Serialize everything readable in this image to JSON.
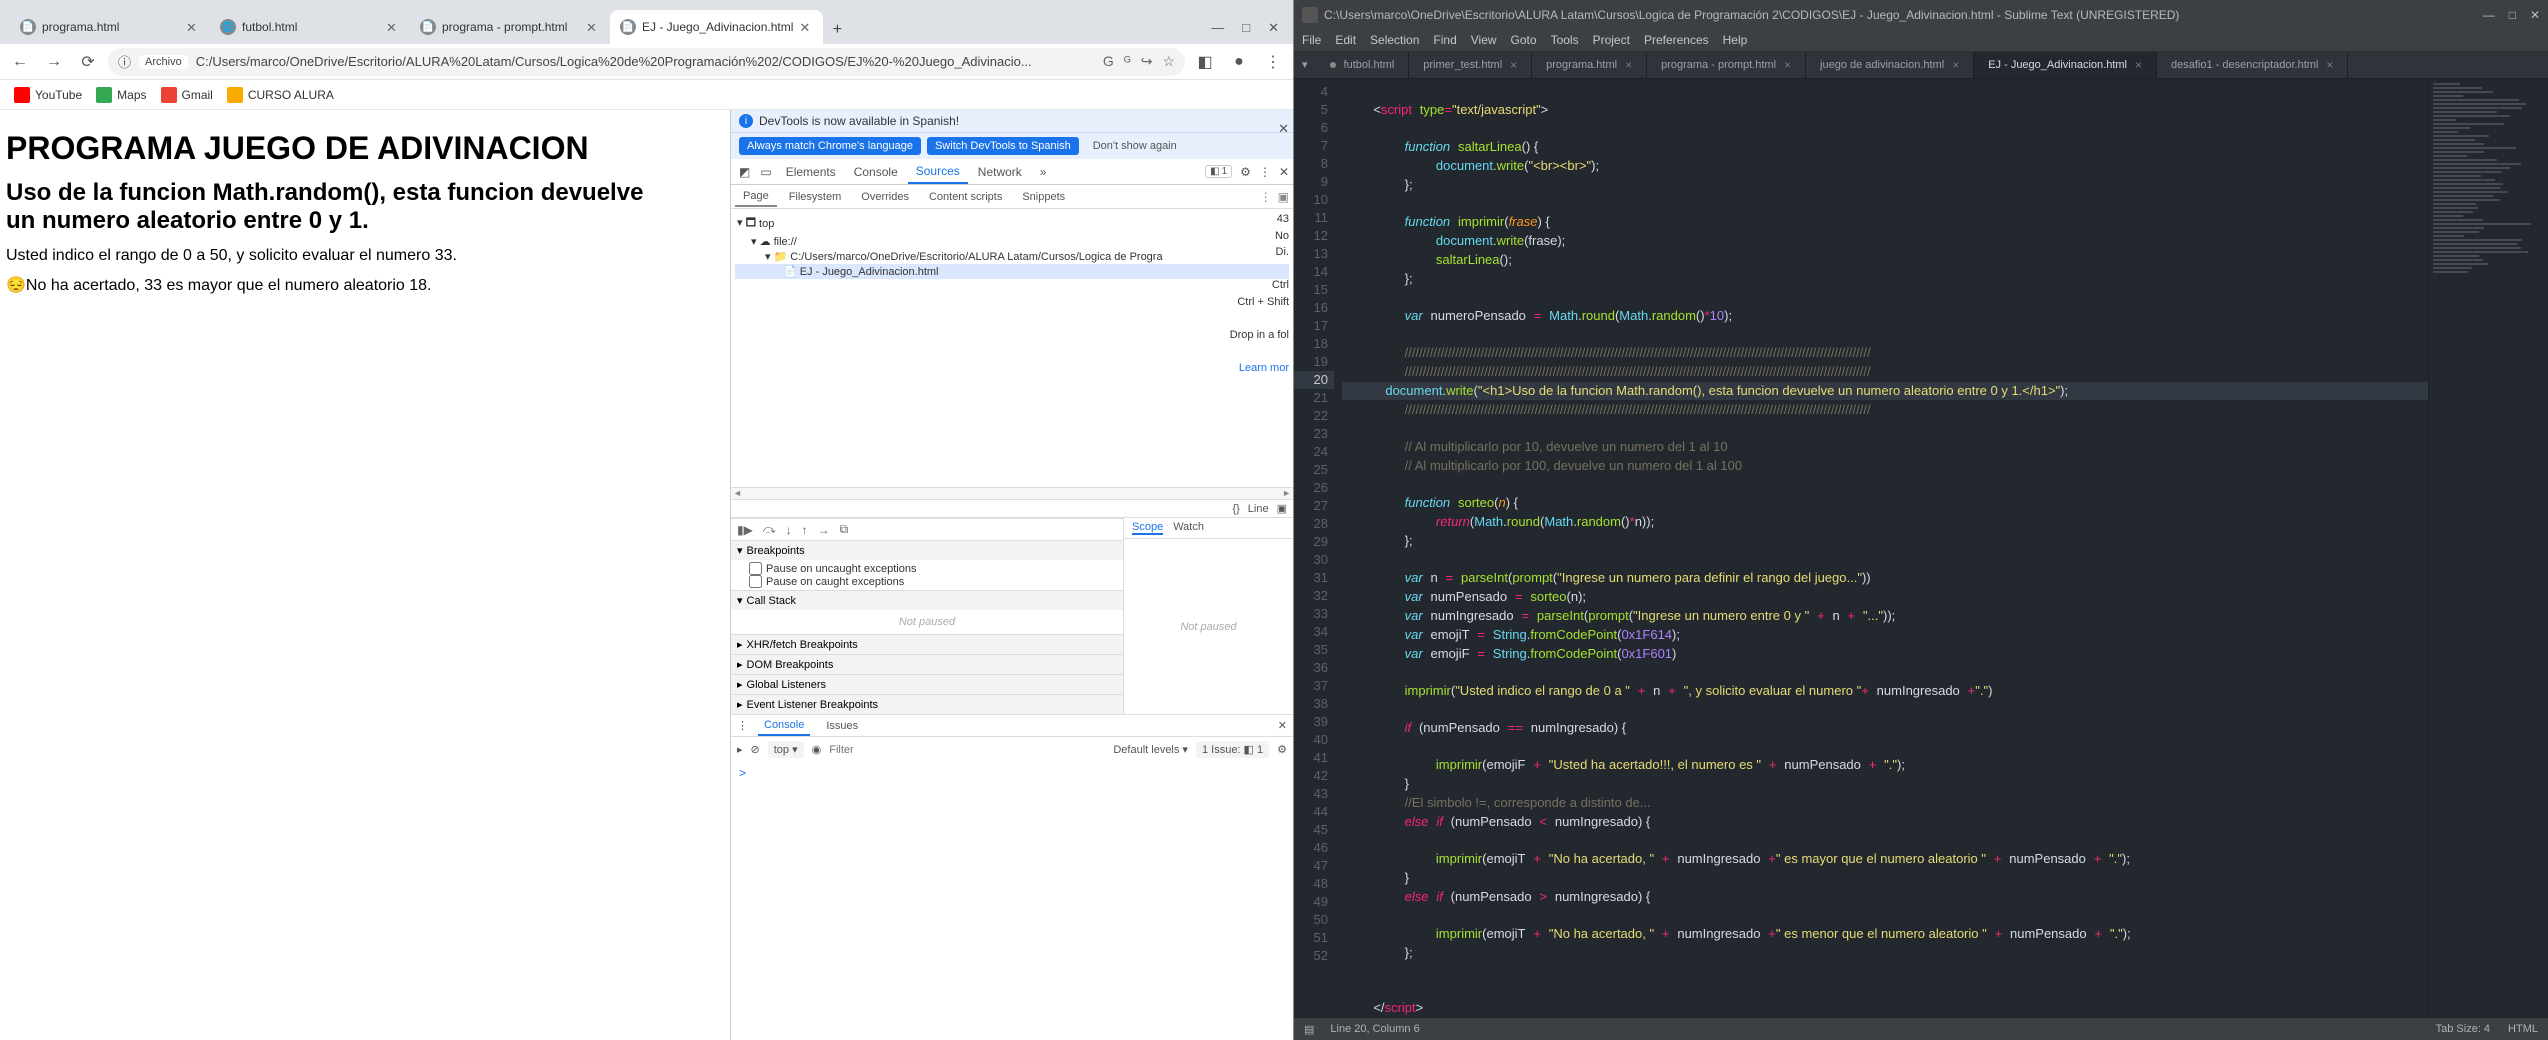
{
  "chrome": {
    "tabs": [
      {
        "title": "programa.html",
        "active": false
      },
      {
        "title": "futbol.html",
        "active": false
      },
      {
        "title": "programa - prompt.html",
        "active": false
      },
      {
        "title": "EJ - Juego_Adivinacion.html",
        "active": true
      }
    ],
    "winctrl": {
      "min": "—",
      "max": "□",
      "close": "✕"
    },
    "nav": {
      "back": "←",
      "fwd": "→",
      "reload": "⟳"
    },
    "addr_label": "Archivo",
    "addr_url": "C:/Users/marco/OneDrive/Escritorio/ALURA%20Latam/Cursos/Logica%20de%20Programación%202/CODIGOS/EJ%20-%20Juego_Adivinacio...",
    "addr_icons": {
      "g": "G",
      "trans": "ᴳ",
      "share": "↪",
      "star": "☆",
      "ext": "◧",
      "avatar": "●",
      "menu": "⋮"
    },
    "bookmarks": [
      {
        "label": "YouTube",
        "color": "#ff0000"
      },
      {
        "label": "Maps",
        "color": "#34a853"
      },
      {
        "label": "Gmail",
        "color": "#ea4335"
      },
      {
        "label": "CURSO ALURA",
        "color": "#f9ab00"
      }
    ],
    "page": {
      "h1": "PROGRAMA JUEGO DE ADIVINACION",
      "h2": "Uso de la funcion Math.random(), esta funcion devuelve un numero aleatorio entre 0 y 1.",
      "p1": "Usted indico el rango de 0 a 50, y solicito evaluar el numero 33.",
      "p2_emoji": "😔",
      "p2": "No ha acertado, 33 es mayor que el numero aleatorio 18."
    },
    "devtools": {
      "banner": "DevTools is now available in Spanish!",
      "btn1": "Always match Chrome's language",
      "btn2": "Switch DevTools to Spanish",
      "btn3": "Don't show again",
      "tabs": [
        "Elements",
        "Console",
        "Sources",
        "Network"
      ],
      "tabs_more": "»",
      "issues_badge": "1",
      "subtabs": [
        "Page",
        "Filesystem",
        "Overrides",
        "Content scripts",
        "Snippets"
      ],
      "tree_top": "top",
      "tree_file": "file://",
      "tree_folder": "C:/Users/marco/OneDrive/Escritorio/ALURA Latam/Cursos/Logica de Progra",
      "tree_leaf": "EJ - Juego_Adivinacion.html",
      "overflow_lines": [
        "43",
        "No",
        "Di.",
        "Ctrl",
        "Ctrl + Shift",
        "Drop in a fol"
      ],
      "learn_more": "Learn mor",
      "line_label": "Line",
      "dbg_icons": [
        "▮▶",
        "⤼",
        "↓",
        "↑",
        "→",
        "⧉"
      ],
      "scope_tabs": [
        "Scope",
        "Watch"
      ],
      "not_paused": "Not paused",
      "acc": [
        {
          "t": "Breakpoints",
          "items": [
            "Pause on uncaught exceptions",
            "Pause on caught exceptions"
          ]
        },
        {
          "t": "Call Stack",
          "np": "Not paused"
        },
        {
          "t": "XHR/fetch Breakpoints"
        },
        {
          "t": "DOM Breakpoints"
        },
        {
          "t": "Global Listeners"
        },
        {
          "t": "Event Listener Breakpoints"
        }
      ],
      "console_tabs": [
        "Console",
        "Issues"
      ],
      "filter_placeholder": "Filter",
      "top_pill": "top ▾",
      "levels": "Default levels ▾",
      "issue_chip": "1 Issue: ◧ 1",
      "prompt": ">"
    }
  },
  "sublime": {
    "title": "C:\\Users\\marco\\OneDrive\\Escritorio\\ALURA Latam\\Cursos\\Logica de Programación 2\\CODIGOS\\EJ - Juego_Adivinacion.html - Sublime Text (UNREGISTERED)",
    "menu": [
      "File",
      "Edit",
      "Selection",
      "Find",
      "View",
      "Goto",
      "Tools",
      "Project",
      "Preferences",
      "Help"
    ],
    "tabs": [
      {
        "t": "futbol.html",
        "dirty": true
      },
      {
        "t": "primer_test.html",
        "dirty": false
      },
      {
        "t": "programa.html",
        "dirty": false
      },
      {
        "t": "programa - prompt.html",
        "dirty": false
      },
      {
        "t": "juego de adivinacion.html",
        "dirty": false
      },
      {
        "t": "EJ - Juego_Adivinacion.html",
        "active": true,
        "dirty": false
      },
      {
        "t": "desafio1 - desencriptador.html",
        "dirty": false
      }
    ],
    "gutter_start": 4,
    "gutter_end": 52,
    "highlight_line": 20,
    "status": {
      "pos": "Line 20, Column 6",
      "tab": "Tab Size: 4",
      "lang": "HTML"
    }
  }
}
